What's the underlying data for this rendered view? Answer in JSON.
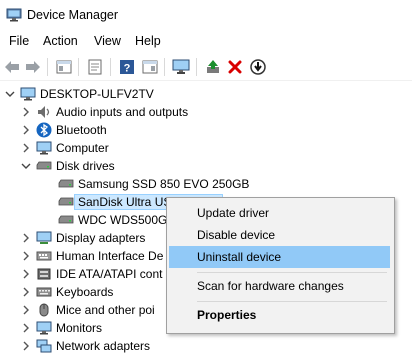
{
  "window": {
    "title": "Device Manager"
  },
  "menu": {
    "file": "File",
    "action": "Action",
    "view": "View",
    "help": "Help"
  },
  "toolbar": {
    "buttons": [
      "back-icon",
      "forward-icon",
      "show-hide-console-tree-icon",
      "properties-icon",
      "help-icon",
      "action-pane-icon",
      "scan-hardware-icon",
      "update-driver-icon",
      "uninstall-icon",
      "disable-device-icon"
    ],
    "colors": {
      "uninstall": "#d90000",
      "help": "#2b5797",
      "update": "#1b8f2e"
    }
  },
  "tree": {
    "root": "DESKTOP-ULFV2TV",
    "categories": {
      "audio": "Audio inputs and outputs",
      "bluetooth": "Bluetooth",
      "computer": "Computer",
      "disk_drives": "Disk drives",
      "display_adapters": "Display adapters",
      "hid": "Human Interface De",
      "ide": "IDE ATA/ATAPI cont",
      "keyboards": "Keyboards",
      "mice": "Mice and other poi",
      "monitors": "Monitors",
      "network": "Network adapters"
    },
    "disks": {
      "samsung": "Samsung SSD 850 EVO 250GB",
      "sandisk": "SanDisk Ultra USB Device",
      "wdc": "WDC WDS500G"
    }
  },
  "context_menu": {
    "update_driver": "Update driver",
    "disable_device": "Disable device",
    "uninstall_device": "Uninstall device",
    "scan": "Scan for hardware changes",
    "properties": "Properties",
    "highlighted": "Uninstall device",
    "highlight_color": "#91c9f7"
  }
}
